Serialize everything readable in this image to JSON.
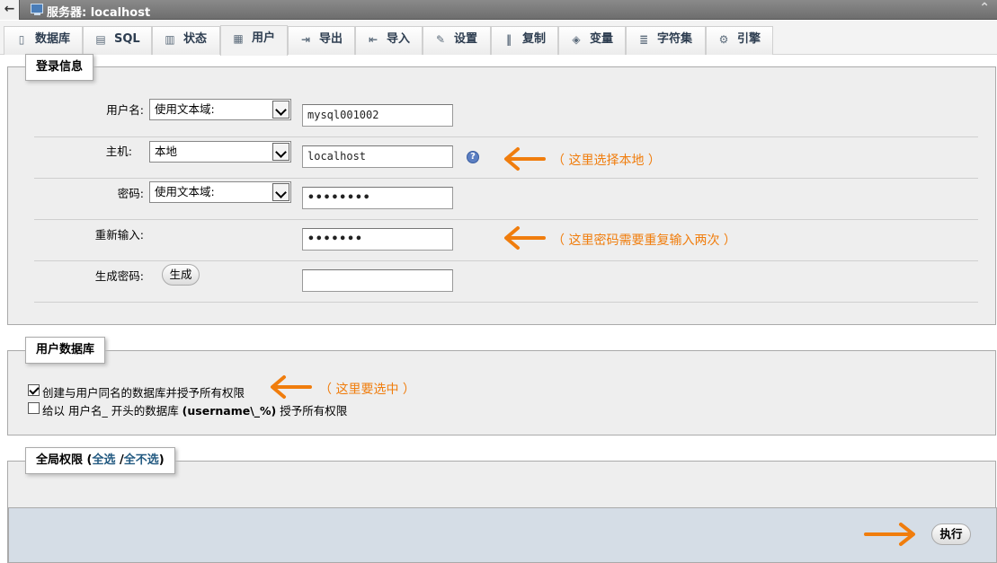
{
  "window": {
    "title": "服务器: localhost",
    "back_label": "←",
    "collapse_label": "⌃"
  },
  "tabs": [
    {
      "label": "数据库",
      "icon": "database-icon"
    },
    {
      "label": "SQL",
      "icon": "sql-icon"
    },
    {
      "label": "状态",
      "icon": "status-icon"
    },
    {
      "label": "用户",
      "icon": "users-icon",
      "active": true
    },
    {
      "label": "导出",
      "icon": "export-icon"
    },
    {
      "label": "导入",
      "icon": "import-icon"
    },
    {
      "label": "设置",
      "icon": "wrench-icon"
    },
    {
      "label": "复制",
      "icon": "replication-icon"
    },
    {
      "label": "变量",
      "icon": "variables-icon"
    },
    {
      "label": "字符集",
      "icon": "charset-icon"
    },
    {
      "label": "引擎",
      "icon": "engine-icon"
    }
  ],
  "login": {
    "legend": "登录信息",
    "username": {
      "label": "用户名:",
      "select": "使用文本域:",
      "value": "mysql001002"
    },
    "host": {
      "label": "主机:",
      "select": "本地",
      "value": "localhost",
      "help": "?"
    },
    "password": {
      "label": "密码:",
      "select": "使用文本域:",
      "value": "••••••••"
    },
    "retype": {
      "label": "重新输入:",
      "value": "•••••••"
    },
    "generate": {
      "label": "生成密码:",
      "button": "生成",
      "value": ""
    }
  },
  "userdb": {
    "legend": "用户数据库",
    "option1": {
      "label": "创建与用户同名的数据库并授予所有权限",
      "checked": true
    },
    "option2_prefix": "给以 用户名_ 开头的数据库 ",
    "option2_bold": "(username\\_%)",
    "option2_suffix": " 授予所有权限"
  },
  "global": {
    "legend_prefix": "全局权限 (",
    "check_all": "全选",
    "sep": " /",
    "uncheck_all": "全不选",
    "legend_suffix": ")"
  },
  "footer": {
    "go_button": "执行"
  },
  "annotations": {
    "host_note": "（ 这里选择本地 ）",
    "password_note": "（ 这里密码需要重复输入两次 ）",
    "db_note": "（ 这里要选中 ）"
  },
  "colors": {
    "annotation": "#f07d0d",
    "link": "#235a81",
    "footer_bg": "#d5dde6"
  }
}
